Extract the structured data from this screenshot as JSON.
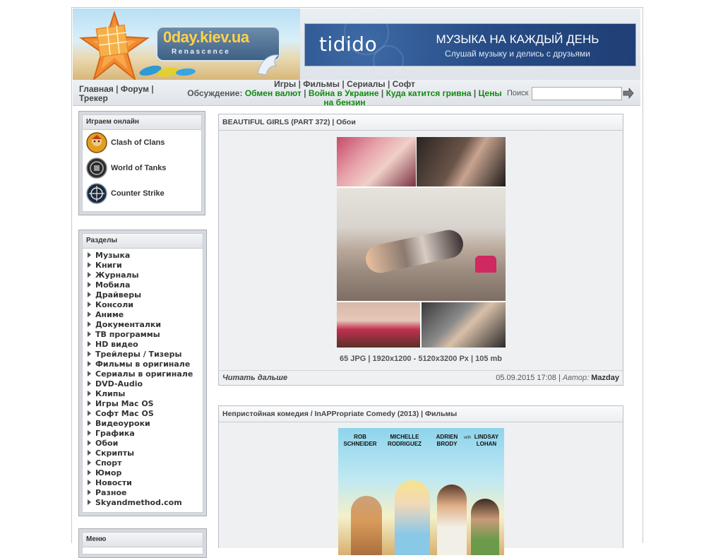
{
  "header": {
    "site_name": "0day.kiev.ua",
    "site_tagline": "Renascence",
    "banner": {
      "brand": "tidido",
      "slogan": "МУЗЫКА НА КАЖДЫЙ ДЕНЬ",
      "subtitle": "Слушай музыку и делись с друзьями"
    }
  },
  "nav": {
    "left": [
      "Главная",
      "Форум",
      "Трекер"
    ],
    "top_links": [
      "Игры",
      "Фильмы",
      "Сериалы",
      "Софт"
    ],
    "discussion_label": "Обсуждение:",
    "discussion_links": [
      "Обмен валют",
      "Война в Украине",
      "Куда катится гривна",
      "Цены на бензин"
    ],
    "search_label": "Поиск",
    "search_value": ""
  },
  "sidebar": {
    "games_title": "Играем онлайн",
    "games": [
      {
        "label": "Clash of Clans",
        "icon": "clash-of-clans-icon"
      },
      {
        "label": "World of Tanks",
        "icon": "world-of-tanks-icon"
      },
      {
        "label": "Counter Strike",
        "icon": "counter-strike-icon"
      }
    ],
    "sections_title": "Разделы",
    "sections": [
      "Музыка",
      "Книги",
      "Журналы",
      "Мобила",
      "Драйверы",
      "Консоли",
      "Аниме",
      "Документалки",
      "ТВ программы",
      "HD видео",
      "Трейлеры / Тизеры",
      "Фильмы в оригинале",
      "Сериалы в оригинале",
      "DVD-Audio",
      "Клипы",
      "Игры Mac OS",
      "Софт Mac OS",
      "Видеоуроки",
      "Графика",
      "Обои",
      "Скрипты",
      "Спорт",
      "Юмор",
      "Новости",
      "Разное",
      "Skyandmethod.com"
    ],
    "menu_title": "Меню"
  },
  "posts": [
    {
      "title": "BEAUTIFUL GIRLS (PART 372)",
      "category": "Обои",
      "info": "65 JPG | 1920x1200 - 5120x3200 Px | 105 mb",
      "read_more": "Читать дальше",
      "date": "05.09.2015 17:08",
      "author_label": "Автор:",
      "author": "Mazday"
    },
    {
      "title": "Непристойная комедия / InAPPropriate Comedy (2013)",
      "category": "Фильмы",
      "poster_names": [
        "ROB SCHNEIDER",
        "MICHELLE RODRIGUEZ",
        "ADRIEN BRODY",
        "LINDSAY LOHAN"
      ],
      "poster_with": "with"
    }
  ],
  "colors": {
    "discussion_link": "#108a10",
    "banner_bg": "#274c86",
    "block_bg": "#d6dadf"
  }
}
